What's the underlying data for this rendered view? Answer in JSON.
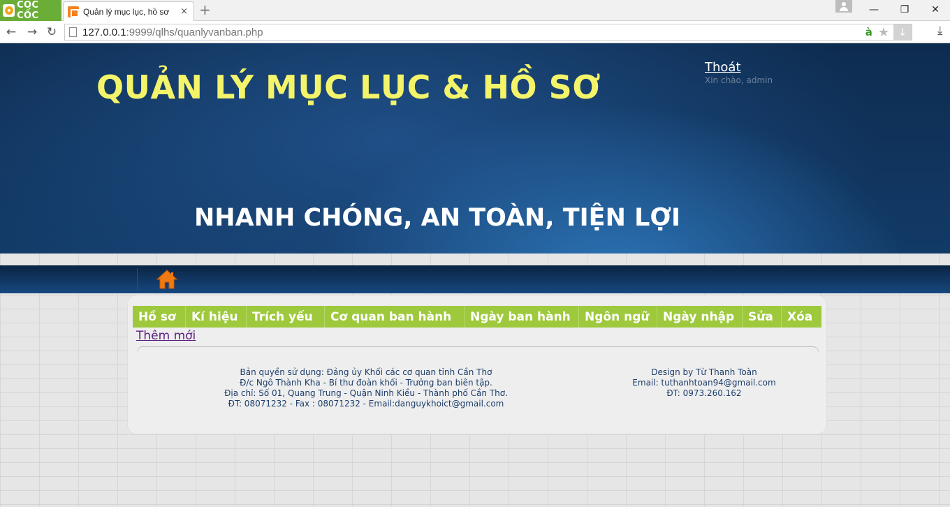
{
  "browser": {
    "brand": "CỐC CỐC",
    "tab_title": "Quản lý mục lục, hồ sơ",
    "tab_close": "×",
    "new_tab": "+",
    "url_host": "127.0.0.1",
    "url_rest": ":9999/qlhs/quanlyvanban.php",
    "ext_label": "à"
  },
  "header": {
    "site_title": "QUẢN LÝ MỤC LỤC & HỒ SƠ",
    "slogan": "NHANH CHÓNG, AN TOÀN, TIỆN LỢI",
    "logout": "Thoát",
    "greeting": "Xin chào, admin"
  },
  "nav": {
    "home_icon": "home-icon"
  },
  "table": {
    "columns": [
      "Hồ sơ",
      "Kí hiệu",
      "Trích yếu",
      "Cơ quan ban hành",
      "Ngày ban hành",
      "Ngôn ngữ",
      "Ngày nhập",
      "Sửa",
      "Xóa"
    ],
    "add_new": "Thêm mới"
  },
  "footer": {
    "left": [
      "Bản quyền sử dụng: Đảng ủy Khối các cơ quan tỉnh Cần Thơ",
      "Đ/c Ngô Thành Kha - Bí thư đoàn khối - Trưởng ban biên tập.",
      "Địa chỉ: Số 01, Quang Trung - Quận Ninh Kiều - Thành phố Cần Thơ.",
      "ĐT: 08071232 - Fax : 08071232 - Email:danguykhoict@gmail.com"
    ],
    "right": [
      "Design by Từ Thanh Toàn",
      "Email: tuthanhtoan94@gmail.com",
      "ĐT: 0973.260.162"
    ]
  },
  "colors": {
    "title_yellow": "#f4f46a",
    "header_green": "#9ec93c",
    "banner_dark": "#0e2c50",
    "link_purple": "#5a1d7e"
  }
}
